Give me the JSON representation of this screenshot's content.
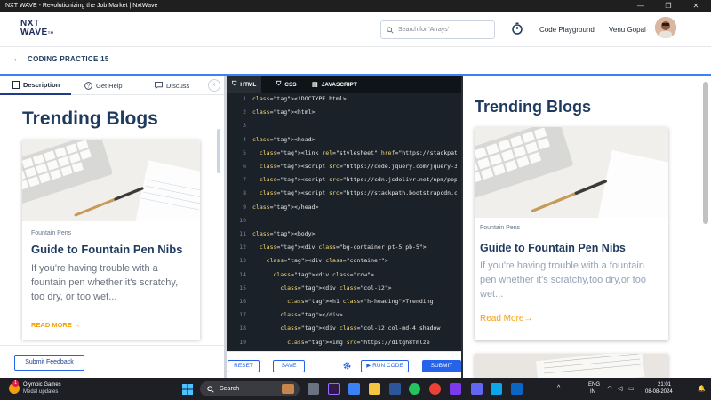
{
  "window": {
    "title": "NXT WAVE - Revolutionizing the Job Market | NxtWave"
  },
  "header": {
    "logo_line1": "NXT",
    "logo_line2": "WAVE",
    "logo_tm": "TM",
    "search_placeholder": "Search for 'Arrays'",
    "code_playground": "Code Playground",
    "user_name": "Venu Gopal"
  },
  "breadcrumb": {
    "title": "CODING PRACTICE 15"
  },
  "left_panel": {
    "tabs": [
      {
        "label": "Description"
      },
      {
        "label": "Get Help"
      },
      {
        "label": "Discuss"
      }
    ],
    "heading": "Trending Blogs",
    "card": {
      "category": "Fountain Pens",
      "title": "Guide to Fountain Pen Nibs",
      "description": "If you're having trouble with a fountain pen whether it's scratchy, too dry, or too wet...",
      "read_more": "READ MORE →"
    },
    "feedback_button": "Submit Feedback"
  },
  "editor": {
    "tabs": [
      {
        "label": "HTML"
      },
      {
        "label": "CSS"
      },
      {
        "label": "JAVASCRIPT"
      }
    ],
    "buttons": {
      "reset": "RESET",
      "save": "SAVE",
      "run": "RUN CODE",
      "submit": "SUBMIT"
    }
  },
  "preview": {
    "heading": "Trending Blogs",
    "card": {
      "category": "Fountain Pens",
      "title": "Guide to Fountain Pen Nibs",
      "description": "If you're having trouble with a fountain pen whether it's scratchy,too dry,or too wet...",
      "read_more": "Read More→"
    }
  },
  "taskbar": {
    "weather_title": "Olympic Games",
    "weather_sub": "Medal updates",
    "search_label": "Search",
    "lang_line1": "ENG",
    "lang_line2": "IN",
    "time": "21:01",
    "date": "08-08-2024",
    "notification_count": "1"
  },
  "colors": {
    "brand": "#1e3a5f",
    "accent": "#2563eb",
    "highlight": "#f59e0b",
    "editor_bg": "#1b2128"
  }
}
